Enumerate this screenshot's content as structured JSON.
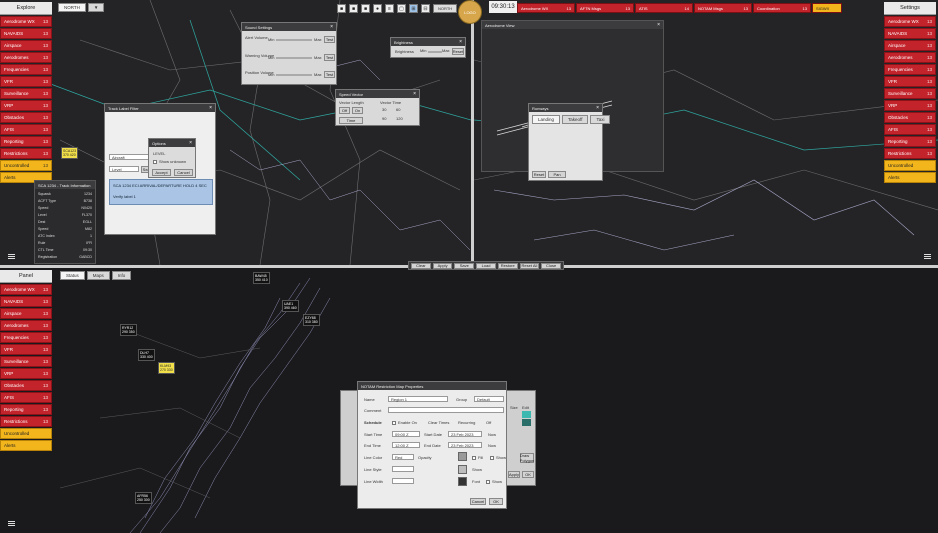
{
  "topbar": {
    "buttons": [
      "■",
      "■",
      "■",
      "●",
      "≡",
      "▢",
      "⊞",
      "⊟"
    ],
    "button_text": "NORTH",
    "logo": "LOGO",
    "clock": "09:30:13",
    "alerts": [
      {
        "label": "Aerodrome WX",
        "count": "13"
      },
      {
        "label": "AFTN Msgs",
        "count": "13"
      },
      {
        "label": "ATIS",
        "count": "14"
      },
      {
        "label": "NOTAM Msgs",
        "count": "13"
      },
      {
        "label": "Coordination",
        "count": "13"
      },
      {
        "label": "Aerodrome",
        "count": "13"
      }
    ],
    "alert_yellow": "SIGWX",
    "settings_label": "Settings"
  },
  "left_menu": {
    "header": "Explore",
    "items": [
      {
        "label": "Aerodrome WX",
        "count": "13"
      },
      {
        "label": "NAVAIDS",
        "count": "13"
      },
      {
        "label": "Airspace",
        "count": "13"
      },
      {
        "label": "Aerodromes",
        "count": "13"
      },
      {
        "label": "Frequencies",
        "count": "13"
      },
      {
        "label": "VFR",
        "count": "13"
      },
      {
        "label": "Surveillance",
        "count": "13"
      },
      {
        "label": "VRP",
        "count": "13"
      },
      {
        "label": "Obstacles",
        "count": "13"
      },
      {
        "label": "AFIS",
        "count": "13"
      },
      {
        "label": "Reporting",
        "count": "13"
      },
      {
        "label": "Restrictions",
        "count": "13"
      },
      {
        "label": "Uncontrolled",
        "count": "13"
      },
      {
        "label": "Alerts",
        "count": ""
      }
    ]
  },
  "right_menu": {
    "header": "Settings",
    "items": [
      {
        "label": "Aerodrome WX",
        "count": "13"
      },
      {
        "label": "NAVAIDS",
        "count": "13"
      },
      {
        "label": "Airspace",
        "count": "13"
      },
      {
        "label": "Aerodromes",
        "count": "13"
      },
      {
        "label": "Frequencies",
        "count": "13"
      },
      {
        "label": "VFR",
        "count": "13"
      },
      {
        "label": "Surveillance",
        "count": "13"
      },
      {
        "label": "VRP",
        "count": "13"
      },
      {
        "label": "Obstacles",
        "count": "13"
      },
      {
        "label": "AFIS",
        "count": "13"
      },
      {
        "label": "Reporting",
        "count": "13"
      },
      {
        "label": "Restrictions",
        "count": "13"
      },
      {
        "label": "Uncontrolled",
        "count": ""
      },
      {
        "label": "Alerts",
        "count": ""
      }
    ]
  },
  "bottom_menu": {
    "header": "Panel",
    "tabs": [
      "Status",
      "Maps",
      "Info"
    ],
    "items": [
      {
        "label": "Aerodrome WX",
        "count": "13"
      },
      {
        "label": "NAVAIDS",
        "count": "13"
      },
      {
        "label": "Airspace",
        "count": "13"
      },
      {
        "label": "Aerodromes",
        "count": "13"
      },
      {
        "label": "Frequencies",
        "count": "13"
      },
      {
        "label": "VFR",
        "count": "13"
      },
      {
        "label": "Surveillance",
        "count": "13"
      },
      {
        "label": "VRP",
        "count": "13"
      },
      {
        "label": "Obstacles",
        "count": "13"
      },
      {
        "label": "AFIS",
        "count": "13"
      },
      {
        "label": "Reporting",
        "count": "13"
      },
      {
        "label": "Restrictions",
        "count": "13"
      },
      {
        "label": "Uncontrolled",
        "count": ""
      },
      {
        "label": "Alerts",
        "count": ""
      }
    ]
  },
  "top_tabs": [
    "NORTH",
    "▼"
  ],
  "sound_dialog": {
    "title": "Sound Settings",
    "rows": [
      {
        "label": "Alert Volume",
        "min": "Min",
        "max": "Max",
        "btn": "Test"
      },
      {
        "label": "Warning Volume",
        "min": "Min",
        "max": "Max",
        "btn": "Test"
      },
      {
        "label": "Position Volume",
        "min": "Min",
        "max": "Max",
        "btn": "Test"
      }
    ]
  },
  "brightness_dialog": {
    "title": "Brightness",
    "label": "Brightness",
    "min": "Min",
    "max": "Max",
    "btn": "Reset"
  },
  "speed_dialog": {
    "title": "Speed Vector",
    "col1": "Vector Length",
    "col2": "Vector Time",
    "buttons": [
      "Off",
      "On",
      "Time"
    ],
    "values": [
      "30",
      "60",
      "90",
      "120"
    ]
  },
  "filter_dialog": {
    "title": "Track Label Filter",
    "fields": [
      "Aircraft",
      "Level"
    ],
    "search_btn": "Search",
    "list_item": "SCA 1234 ECI ARRIVAL/DEPARTURE HOLD 4 SEC",
    "list_item2": "Verify label 1",
    "inner_title": "Options",
    "inner_options": [
      "LEVEL",
      "Show unknown"
    ],
    "inner_buttons": [
      "Accept",
      "Cancel"
    ]
  },
  "track_info": {
    "title": "SCA 1234 - Track Information",
    "rows": [
      {
        "k": "Squawk",
        "v": "1234"
      },
      {
        "k": "ACFT Type",
        "v": "B738"
      },
      {
        "k": "Speed",
        "v": "N0420"
      },
      {
        "k": "Level",
        "v": "FL370"
      },
      {
        "k": "Dest",
        "v": "EGLL"
      },
      {
        "k": "Speed",
        "v": "M82"
      },
      {
        "k": "ATC Index",
        "v": "1"
      },
      {
        "k": "Rule",
        "v": "IFR"
      },
      {
        "k": "CTL Time",
        "v": "09:30"
      },
      {
        "k": "Registration",
        "v": "GABCD"
      }
    ]
  },
  "runway_window": {
    "title": "Aerodrome View",
    "panel_title": "Runways",
    "tabs": [
      "Landing",
      "Takeoff",
      "Taxi"
    ],
    "buttons": [
      "Reset",
      "Pan"
    ]
  },
  "middle_bar": [
    "Clear",
    "Apply",
    "Save",
    "Load",
    "Restore",
    "Reset All",
    "Close"
  ],
  "map_props": {
    "title": "NOTAM Restriction Map Properties",
    "name_label": "Name",
    "name_value": "Region 1",
    "group_label": "Group",
    "group_value": "Default",
    "comment_label": "Comment",
    "schedule_label": "Schedule",
    "enable_label": "Enable On",
    "clear_label": "Clear Times",
    "recurring_label": "Recurring",
    "off_label": "Off",
    "start_time_label": "Start Time",
    "start_time": "09:00 Z",
    "start_date_label": "Start Date",
    "start_date": "23 Feb 2023",
    "end_time_label": "End Time",
    "end_time": "12:00 Z",
    "end_date_label": "End Date",
    "end_date": "23 Feb 2023",
    "now_label": "Now",
    "line_label": "Line Color",
    "line_value": "Red",
    "fill_label": "Fill",
    "show_label": "Show",
    "opacity_label": "Opacity",
    "line_style_label": "Line Style",
    "line_width_label": "Line Width",
    "font_label": "Font",
    "buttons": [
      "Cancel",
      "OK"
    ],
    "side_labels": [
      "Size",
      "Edit",
      "Draw Polygon",
      "Apply",
      "OK"
    ]
  },
  "tracks": [
    {
      "callsign": "SCA123",
      "info": "370 420"
    },
    {
      "callsign": "BAW45",
      "info": "350 410"
    },
    {
      "callsign": "EZY88",
      "info": "310 380"
    },
    {
      "callsign": "RYR12",
      "info": "290 350"
    },
    {
      "callsign": "DLH7",
      "info": "330 400"
    },
    {
      "callsign": "KLM93",
      "info": "270 330"
    },
    {
      "callsign": "AFR56",
      "info": "250 300"
    },
    {
      "callsign": "UAE1",
      "info": "390 460"
    }
  ],
  "colors": {
    "red": "#c3232b",
    "yellow": "#f2b51c",
    "pane": "#242426"
  }
}
